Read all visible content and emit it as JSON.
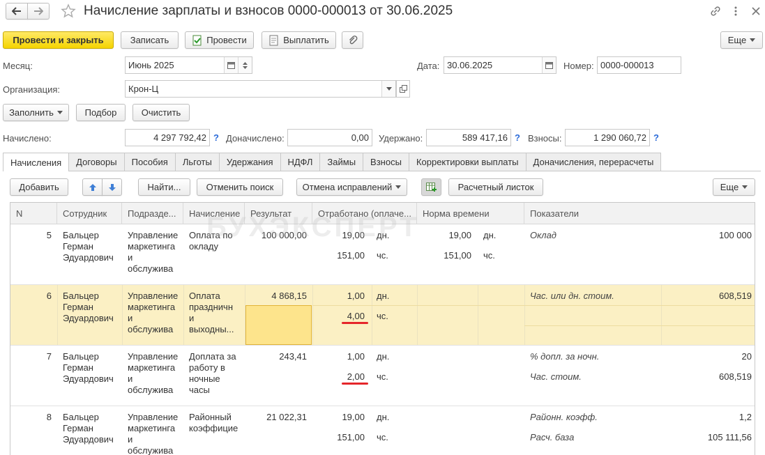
{
  "title": "Начисление зарплаты и взносов 0000-000013 от 30.06.2025",
  "toolbar": {
    "post_close": "Провести и закрыть",
    "save": "Записать",
    "post": "Провести",
    "pay": "Выплатить",
    "more": "Еще"
  },
  "form": {
    "month_label": "Месяц:",
    "month_value": "Июнь 2025",
    "date_label": "Дата:",
    "date_value": "30.06.2025",
    "number_label": "Номер:",
    "number_value": "0000-000013",
    "org_label": "Организация:",
    "org_value": "Крон-Ц"
  },
  "actions": {
    "fill": "Заполнить",
    "select": "Подбор",
    "clear": "Очистить"
  },
  "totals": {
    "accrued_label": "Начислено:",
    "accrued_value": "4 297 792,42",
    "extra_label": "Доначислено:",
    "extra_value": "0,00",
    "withheld_label": "Удержано:",
    "withheld_value": "589 417,16",
    "contrib_label": "Взносы:",
    "contrib_value": "1 290 060,72",
    "help": "?"
  },
  "tabs": [
    "Начисления",
    "Договоры",
    "Пособия",
    "Льготы",
    "Удержания",
    "НДФЛ",
    "Займы",
    "Взносы",
    "Корректировки выплаты",
    "Доначисления, перерасчеты"
  ],
  "grid_toolbar": {
    "add": "Добавить",
    "find": "Найти...",
    "cancel_search": "Отменить поиск",
    "cancel_fix": "Отмена исправлений",
    "payslip": "Расчетный листок",
    "more": "Еще"
  },
  "columns": [
    "N",
    "Сотрудник",
    "Подразде...",
    "Начисление",
    "Результат",
    "Отработано (оплаче...",
    "Норма времени",
    "Показатели"
  ],
  "watermark": "БУХЭКСПЕРТ",
  "rows": [
    {
      "n": "5",
      "employee": "Бальцер\nГерман\nЭдуардович",
      "dept": "Управление\nмаркетинга\nи\nобслужива",
      "accrual": "Оплата по\nокладу",
      "result": "100 000,00",
      "worked1": "19,00",
      "unit1": "дн.",
      "worked2": "151,00",
      "unit2": "чс.",
      "norm1": "19,00",
      "nunit1": "дн.",
      "norm2": "151,00",
      "nunit2": "чс.",
      "ind1": "Оклад",
      "val1": "100 000",
      "ind2": "",
      "val2": ""
    },
    {
      "n": "6",
      "employee": "Бальцер\nГерман\nЭдуардович",
      "dept": "Управление\nмаркетинга\nи\nобслужива",
      "accrual": "Оплата\nпраздничн\n и\nвыходны...",
      "result": "4 868,15",
      "worked1": "1,00",
      "unit1": "дн.",
      "worked2": "4,00",
      "unit2": "чс.",
      "norm1": "",
      "nunit1": "",
      "norm2": "",
      "nunit2": "",
      "ind1": "Час. или дн. стоим.",
      "val1": "608,519",
      "ind2": "",
      "val2": ""
    },
    {
      "n": "7",
      "employee": "Бальцер\nГерман\nЭдуардович",
      "dept": "Управление\nмаркетинга\nи\nобслужива",
      "accrual": "Доплата за\nработу в\nночные\nчасы",
      "result": "243,41",
      "worked1": "1,00",
      "unit1": "дн.",
      "worked2": "2,00",
      "unit2": "чс.",
      "norm1": "",
      "nunit1": "",
      "norm2": "",
      "nunit2": "",
      "ind1": "% допл. за ночн.",
      "val1": "20",
      "ind2": "Час. стоим.",
      "val2": "608,519"
    },
    {
      "n": "8",
      "employee": "Бальцер\nГерман\nЭдуардович",
      "dept": "Управление\nмаркетинга\nи\nобслужива",
      "accrual": "Районный\nкоэффицие",
      "result": "21 022,31",
      "worked1": "19,00",
      "unit1": "дн.",
      "worked2": "151,00",
      "unit2": "чс.",
      "norm1": "",
      "nunit1": "",
      "norm2": "",
      "nunit2": "",
      "ind1": "Районн. коэфф.",
      "val1": "1,2",
      "ind2": "Расч. база",
      "val2": "105 111,56"
    }
  ]
}
